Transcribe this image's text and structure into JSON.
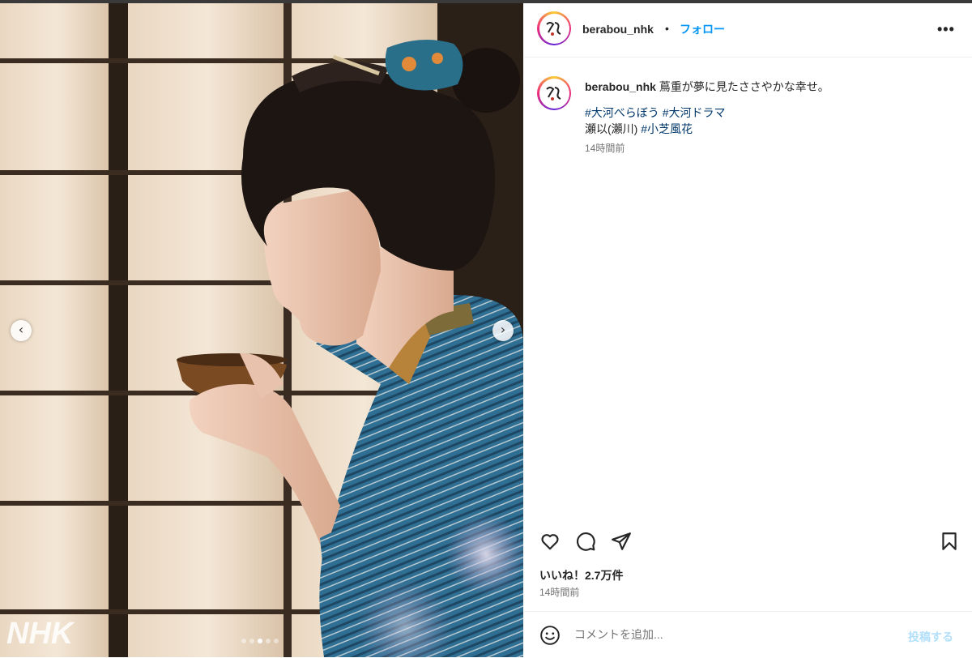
{
  "post": {
    "username": "berabou_nhk",
    "separator": "•",
    "follow_label": "フォロー",
    "more_label": "•••",
    "caption": {
      "text": "蔦重が夢に見たささやかな幸せ。",
      "tags_line1": [
        "#大河べらぼう",
        "#大河ドラマ"
      ],
      "credit_prefix": "瀬以(瀬川)",
      "credit_tag": "#小芝風花",
      "timestamp": "14時間前"
    },
    "likes_label": "いいね！2.7万件",
    "posted_time": "14時間前",
    "comment": {
      "placeholder": "コメントを追加...",
      "post_label": "投稿する"
    }
  },
  "photo": {
    "watermark": "NHK",
    "carousel": {
      "total": 5,
      "active": 2
    }
  },
  "colors": {
    "link_blue": "#0095f6",
    "hashtag": "#00376b",
    "muted": "#737373",
    "post_disabled": "#b2dffc"
  },
  "icons": [
    "chevron-left-icon",
    "chevron-right-icon",
    "more-icon",
    "heart-icon",
    "comment-icon",
    "share-icon",
    "bookmark-icon",
    "emoji-icon"
  ]
}
